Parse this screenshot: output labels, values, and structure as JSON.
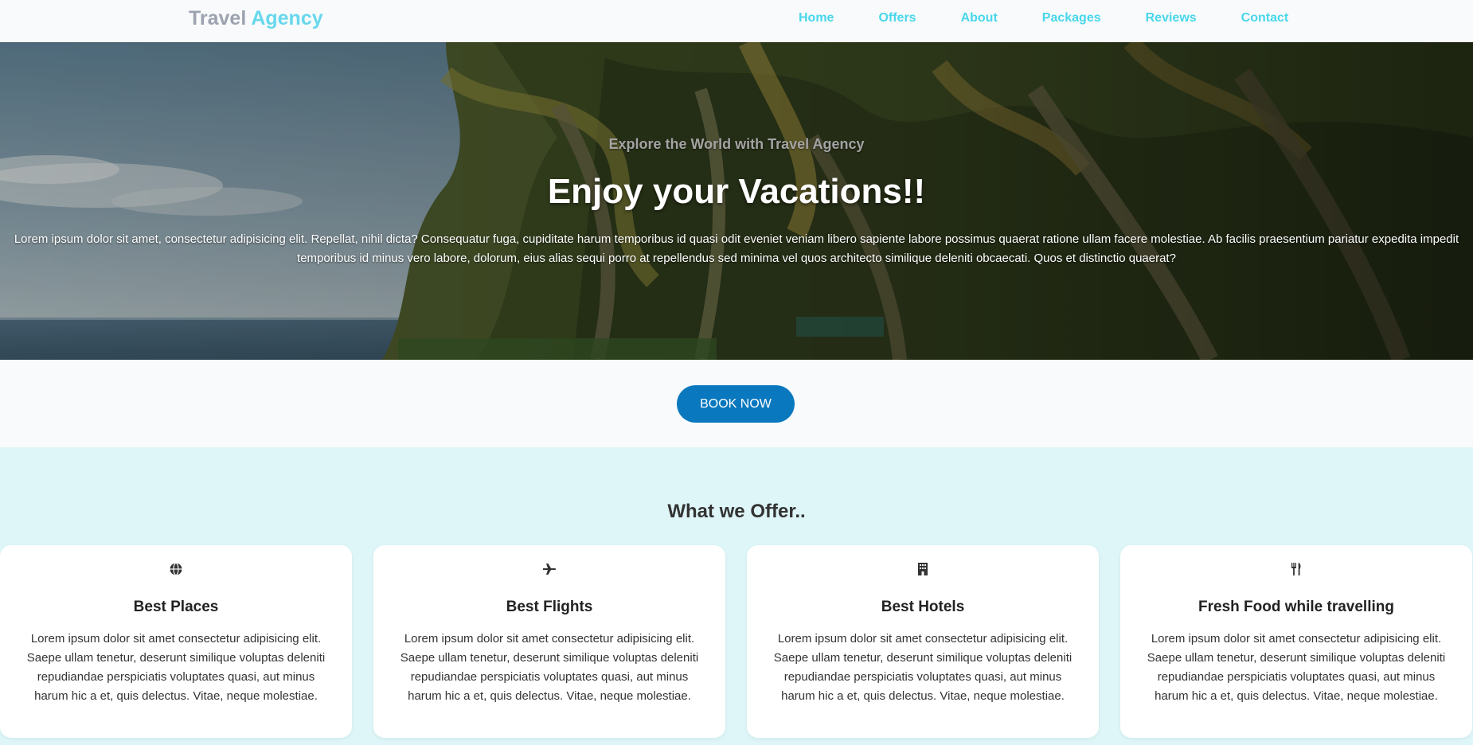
{
  "brand": {
    "part1": "Travel",
    "part2": "Agency"
  },
  "nav": {
    "home": "Home",
    "offers": "Offers",
    "about": "About",
    "packages": "Packages",
    "reviews": "Reviews",
    "contact": "Contact"
  },
  "hero": {
    "kicker": "Explore the World with Travel Agency",
    "title": "Enjoy your Vacations!!",
    "text": "Lorem ipsum dolor sit amet, consectetur adipisicing elit. Repellat, nihil dicta? Consequatur fuga, cupiditate harum temporibus id quasi odit eveniet veniam libero sapiente labore possimus quaerat ratione ullam facere molestiae. Ab facilis praesentium pariatur expedita impedit temporibus id minus vero labore, dolorum, eius alias sequi porro at repellendus sed minima vel quos architecto similique deleniti obcaecati. Quos et distinctio quaerat?"
  },
  "book": {
    "label": "BOOK NOW"
  },
  "offer": {
    "title": "What we Offer..",
    "cards": [
      {
        "icon": "globe-icon",
        "title": "Best Places",
        "text": "Lorem ipsum dolor sit amet consectetur adipisicing elit. Saepe ullam tenetur, deserunt similique voluptas deleniti repudiandae perspiciatis voluptates quasi, aut minus harum hic a et, quis delectus. Vitae, neque molestiae."
      },
      {
        "icon": "plane-icon",
        "title": "Best Flights",
        "text": "Lorem ipsum dolor sit amet consectetur adipisicing elit. Saepe ullam tenetur, deserunt similique voluptas deleniti repudiandae perspiciatis voluptates quasi, aut minus harum hic a et, quis delectus. Vitae, neque molestiae."
      },
      {
        "icon": "hotel-icon",
        "title": "Best Hotels",
        "text": "Lorem ipsum dolor sit amet consectetur adipisicing elit. Saepe ullam tenetur, deserunt similique voluptas deleniti repudiandae perspiciatis voluptates quasi, aut minus harum hic a et, quis delectus. Vitae, neque molestiae."
      },
      {
        "icon": "utensils-icon",
        "title": "Fresh Food while travelling",
        "text": "Lorem ipsum dolor sit amet consectetur adipisicing elit. Saepe ullam tenetur, deserunt similique voluptas deleniti repudiandae perspiciatis voluptates quasi, aut minus harum hic a et, quis delectus. Vitae, neque molestiae."
      }
    ]
  },
  "colors": {
    "accent": "#48d7ea",
    "button": "#0a78be",
    "offer_bg": "#def6f8"
  }
}
